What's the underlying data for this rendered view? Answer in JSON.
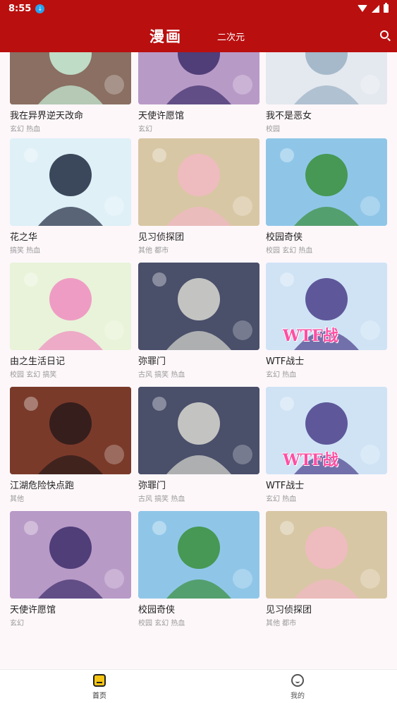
{
  "status": {
    "time": "8:55"
  },
  "header": {
    "title": "漫画",
    "tab": "二次元"
  },
  "cards": [
    {
      "title": "我在异界逆天改命",
      "tags": "玄幻 热血",
      "bg": "#8a6f62",
      "accent": "#c7f0d8"
    },
    {
      "title": "天使许愿馆",
      "tags": "玄幻",
      "bg": "#b89ac7",
      "accent": "#3d2e6b"
    },
    {
      "title": "我不是恶女",
      "tags": "校园",
      "bg": "#e4e8ef",
      "accent": "#9ab0c4"
    },
    {
      "title": "花之华",
      "tags": "搞笑 热血",
      "bg": "#dff0f7",
      "accent": "#1f2a40"
    },
    {
      "title": "见习侦探团",
      "tags": "其他 都市",
      "bg": "#d8c7a4",
      "accent": "#f2b8c4"
    },
    {
      "title": "校园奇侠",
      "tags": "校园 玄幻 热血",
      "bg": "#8fc6e8",
      "accent": "#3a8f3a"
    },
    {
      "title": "由之生活日记",
      "tags": "校园 玄幻 搞笑",
      "bg": "#e8f3d9",
      "accent": "#f08cbf"
    },
    {
      "title": "弥罪门",
      "tags": "古风 搞笑 热血",
      "bg": "#4a4f6a",
      "accent": "#d8d8d0"
    },
    {
      "title": "WTF战士",
      "tags": "玄幻 热血",
      "bg": "#cfe3f5",
      "accent": "#4a3f8a",
      "cover_text": "WTF战"
    },
    {
      "title": "江湖危险快点跑",
      "tags": "其他",
      "bg": "#7a3a2a",
      "accent": "#2a1a1a"
    },
    {
      "title": "弥罪门",
      "tags": "古风 搞笑 热血",
      "bg": "#4a4f6a",
      "accent": "#d8d8d0"
    },
    {
      "title": "WTF战士",
      "tags": "玄幻 热血",
      "bg": "#cfe3f5",
      "accent": "#4a3f8a",
      "cover_text": "WTF战"
    },
    {
      "title": "天使许愿馆",
      "tags": "玄幻",
      "bg": "#b89ac7",
      "accent": "#3d2e6b"
    },
    {
      "title": "校园奇侠",
      "tags": "校园 玄幻 热血",
      "bg": "#8fc6e8",
      "accent": "#3a8f3a"
    },
    {
      "title": "见习侦探团",
      "tags": "其他 都市",
      "bg": "#d8c7a4",
      "accent": "#f2b8c4"
    }
  ],
  "nav": {
    "home": "首页",
    "mine": "我的"
  },
  "colors": {
    "brand": "#ba0f0f",
    "home_icon": "#f6c514"
  }
}
